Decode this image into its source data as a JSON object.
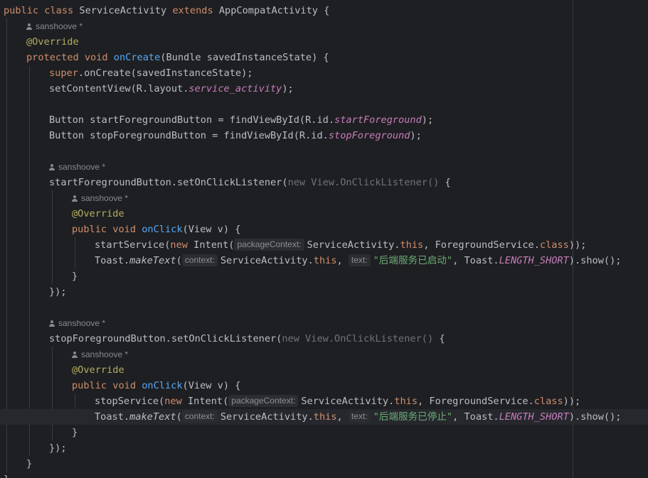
{
  "editor": {
    "author_label": "sanshoove *",
    "line1": {
      "kw1": "public",
      "kw2": "class",
      "name": "ServiceActivity",
      "kw3": "extends",
      "parent": "AppCompatActivity",
      "brace": " {"
    },
    "line3": {
      "ann": "@Override"
    },
    "line4": {
      "kw1": "protected",
      "kw2": "void",
      "fn": "onCreate",
      "rest": "(Bundle savedInstanceState) {"
    },
    "line5": {
      "kw": "super",
      "rest": ".onCreate(savedInstanceState);"
    },
    "line6": {
      "pre": "setContentView(R.layout.",
      "field": "service_activity",
      "post": ");"
    },
    "line8": {
      "pre": "Button startForegroundButton = findViewById(R.id.",
      "field": "startForeground",
      "post": ");"
    },
    "line9": {
      "pre": "Button stopForegroundButton = findViewById(R.id.",
      "field": "stopForeground",
      "post": ");"
    },
    "line12": {
      "pre": "startForegroundButton.setOnClickListener(",
      "dim": "new View.OnClickListener()",
      "post": " {"
    },
    "line14": {
      "ann": "@Override"
    },
    "line15": {
      "kw1": "public",
      "kw2": "void",
      "fn": "onClick",
      "rest": "(View v) {"
    },
    "line16": {
      "pre": "startService(",
      "kw": "new",
      "mid": " Intent(",
      "hint": "packageContext:",
      "cls": "ServiceActivity.",
      "this": "this",
      "mid2": ", ForegroundService.",
      "classkw": "class",
      "post": "));"
    },
    "line17": {
      "pre": "Toast.",
      "m": "makeText",
      "open": "(",
      "hint1": "context:",
      "cls": "ServiceActivity.",
      "this": "this",
      "comma": ",",
      "hint2": "text:",
      "str": "\"后端服务已启动\"",
      "mid": ", Toast.",
      "field": "LENGTH_SHORT",
      "post": ").show();"
    },
    "line18": {
      "text": "}"
    },
    "line19": {
      "text": "});"
    },
    "line22": {
      "pre": "stopForegroundButton.setOnClickListener(",
      "dim": "new View.OnClickListener()",
      "post": " {"
    },
    "line24": {
      "ann": "@Override"
    },
    "line25": {
      "kw1": "public",
      "kw2": "void",
      "fn": "onClick",
      "rest": "(View v) {"
    },
    "line26": {
      "pre": "stopService(",
      "kw": "new",
      "mid": " Intent(",
      "hint": "packageContext:",
      "cls": "ServiceActivity.",
      "this": "this",
      "mid2": ", ForegroundService.",
      "classkw": "class",
      "post": "));"
    },
    "line27": {
      "pre": "Toast.",
      "m": "makeText",
      "open": "(",
      "hint1": "context:",
      "cls": "ServiceActivity.",
      "this": "this",
      "comma": ",",
      "hint2": "text:",
      "str": "\"后端服务已停止\"",
      "mid": ", Toast.",
      "field": "LENGTH_SHORT",
      "post": ").show();"
    },
    "line28": {
      "text": "}"
    },
    "line29": {
      "text": "});"
    },
    "line30": {
      "text": "}"
    },
    "line31": {
      "text": "}"
    }
  }
}
